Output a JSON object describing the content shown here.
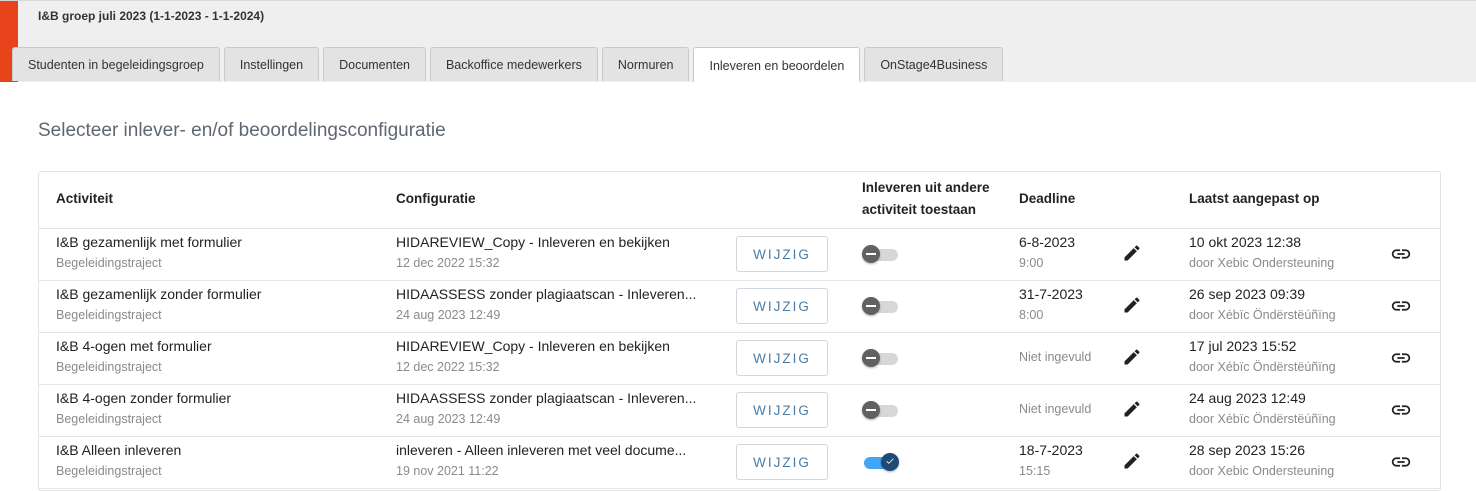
{
  "header": {
    "title": "I&B groep juli 2023 (1-1-2023 - 1-1-2024)"
  },
  "tabs": [
    {
      "label": "Studenten in begeleidingsgroep"
    },
    {
      "label": "Instellingen"
    },
    {
      "label": "Documenten"
    },
    {
      "label": "Backoffice medewerkers"
    },
    {
      "label": "Normuren"
    },
    {
      "label": "Inleveren en beoordelen",
      "active": true
    },
    {
      "label": "OnStage4Business"
    }
  ],
  "section": {
    "title": "Selecteer inlever- en/of beoordelingsconfiguratie"
  },
  "table": {
    "headers": {
      "activiteit": "Activiteit",
      "configuratie": "Configuratie",
      "inleveren_line1": "Inleveren uit andere",
      "inleveren_line2": "activiteit toestaan",
      "deadline": "Deadline",
      "laatst": "Laatst aangepast op"
    },
    "button_label": "WIJZIG",
    "rows": [
      {
        "activity": "I&B gezamenlijk met formulier",
        "activity_sub": "Begeleidingstraject",
        "config": "HIDAREVIEW_Copy - Inleveren en bekijken",
        "config_date": "12 dec 2022 15:32",
        "allow_other": false,
        "deadline_date": "6-8-2023",
        "deadline_time": "9:00",
        "modified": "10 okt 2023 12:38",
        "modified_by": "door Xebic Ondersteuning"
      },
      {
        "activity": "I&B gezamenlijk zonder formulier",
        "activity_sub": "Begeleidingstraject",
        "config": "HIDAASSESS zonder plagiaatscan - Inleveren...",
        "config_date": "24 aug 2023 12:49",
        "allow_other": false,
        "deadline_date": "31-7-2023",
        "deadline_time": "8:00",
        "modified": "26 sep 2023 09:39",
        "modified_by": "door Xébïc Öndërstëúñïng"
      },
      {
        "activity": "I&B 4-ogen met formulier",
        "activity_sub": "Begeleidingstraject",
        "config": "HIDAREVIEW_Copy - Inleveren en bekijken",
        "config_date": "12 dec 2022 15:32",
        "allow_other": false,
        "deadline_empty": "Niet ingevuld",
        "modified": "17 jul 2023 15:52",
        "modified_by": "door Xébïc Öndërstëúñïng"
      },
      {
        "activity": "I&B 4-ogen zonder formulier",
        "activity_sub": "Begeleidingstraject",
        "config": "HIDAASSESS zonder plagiaatscan - Inleveren...",
        "config_date": "24 aug 2023 12:49",
        "allow_other": false,
        "deadline_empty": "Niet ingevuld",
        "modified": "24 aug 2023 12:49",
        "modified_by": "door Xébïc Öndërstëúñïng"
      },
      {
        "activity": "I&B Alleen inleveren",
        "activity_sub": "Begeleidingstraject",
        "config": "inleveren - Alleen inleveren met veel docume...",
        "config_date": "19 nov 2021 11:22",
        "allow_other": true,
        "deadline_date": "18-7-2023",
        "deadline_time": "15:15",
        "modified": "28 sep 2023 15:26",
        "modified_by": "door Xebic Ondersteuning"
      }
    ]
  },
  "colors": {
    "accent": "#e8441c",
    "button_text": "#4a7ea6",
    "toggle_on": "#42a5f5"
  },
  "icons": {
    "edit": "pencil-icon",
    "link": "link-icon"
  }
}
